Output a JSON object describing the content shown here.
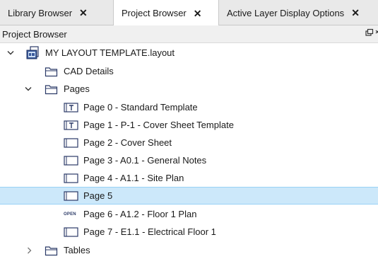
{
  "tabs": [
    {
      "label": "Library Browser",
      "close": "✕"
    },
    {
      "label": "Project Browser",
      "close": "✕"
    },
    {
      "label": "Active Layer Display Options",
      "close": "✕"
    }
  ],
  "panel": {
    "title": "Project Browser",
    "restore_icon": "🗗",
    "close_icon": "✕"
  },
  "tree": {
    "root": {
      "label": "MY LAYOUT TEMPLATE.layout",
      "icon": "layout-file-icon"
    },
    "cad_details": {
      "label": "CAD Details"
    },
    "pages": {
      "label": "Pages"
    },
    "page_items": [
      {
        "label": "Page 0 - Standard Template",
        "icon": "template-page-icon"
      },
      {
        "label": "Page 1 - P-1 - Cover Sheet Template",
        "icon": "template-page-icon"
      },
      {
        "label": "Page 2 - Cover Sheet",
        "icon": "page-icon"
      },
      {
        "label": "Page 3 - A0.1 - General Notes",
        "icon": "page-icon"
      },
      {
        "label": "Page 4 - A1.1 - Site Plan",
        "icon": "page-icon"
      },
      {
        "label": "Page 5",
        "icon": "page-icon",
        "selected": true
      },
      {
        "label": "Page 6 - A1.2 - Floor 1 Plan",
        "icon": "open-badge",
        "badge": "OPEN"
      },
      {
        "label": "Page 7 - E1.1 - Electrical Floor 1",
        "icon": "page-icon"
      }
    ],
    "tables": {
      "label": "Tables"
    }
  },
  "colors": {
    "selection": "#cce8fa",
    "selection_border": "#99d1f5",
    "folder_stroke": "#2b3a67"
  }
}
